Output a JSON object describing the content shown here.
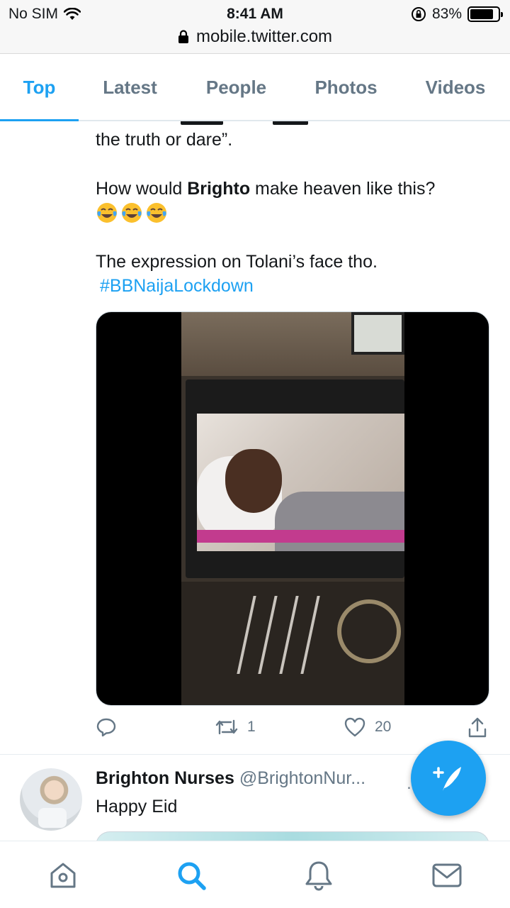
{
  "status_bar": {
    "carrier": "No SIM",
    "time": "8:41 AM",
    "battery_percent": "83%",
    "battery_level": 0.83,
    "url": "mobile.twitter.com"
  },
  "tabs": [
    {
      "label": "Top",
      "active": true
    },
    {
      "label": "Latest",
      "active": false
    },
    {
      "label": "People",
      "active": false
    },
    {
      "label": "Photos",
      "active": false
    },
    {
      "label": "Videos",
      "active": false
    }
  ],
  "tweet": {
    "line_truth": "the truth or dare”.",
    "question_prefix": "How would ",
    "question_bold": "Brighto",
    "question_suffix": " make heaven like this?",
    "emojis": [
      "tears-of-joy",
      "tears-of-joy",
      "tears-of-joy"
    ],
    "expression": "The expression on Tolani’s face tho.",
    "hashtag": "#BBNaijaLockdown",
    "actions": {
      "reply_count": "",
      "retweet_count": "1",
      "like_count": "20"
    }
  },
  "next_tweet": {
    "name": "Brighton Nurses",
    "handle": "@BrightonNur...",
    "text": "Happy Eid"
  },
  "colors": {
    "accent": "#1da1f2",
    "muted": "#657786",
    "text": "#14171a"
  },
  "bottom_nav": [
    "home-icon",
    "search-icon",
    "notifications-icon",
    "messages-icon"
  ]
}
